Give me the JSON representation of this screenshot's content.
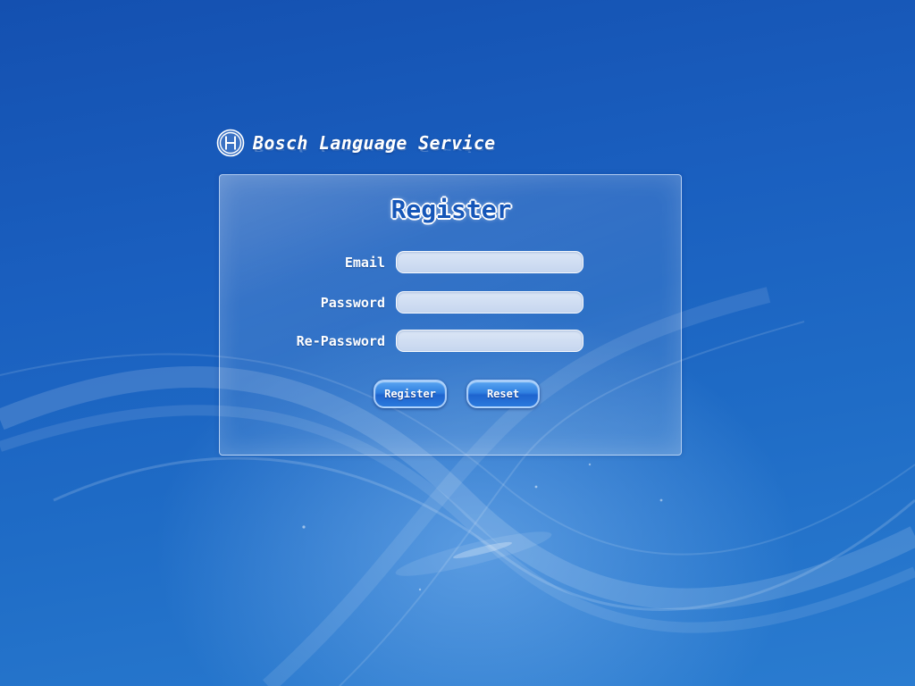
{
  "brand": {
    "name": "Bosch Language Service",
    "logo_icon": "bosch-armature-logo-icon"
  },
  "form": {
    "title": "Register",
    "fields": [
      {
        "label": "Email",
        "value": "",
        "placeholder": ""
      },
      {
        "label": "Password",
        "value": "",
        "placeholder": ""
      },
      {
        "label": "Re-Password",
        "value": "",
        "placeholder": ""
      }
    ],
    "buttons": {
      "register_label": "Register",
      "reset_label": "Reset"
    }
  },
  "colors": {
    "background_top": "#1450b0",
    "background_bottom": "#2a7cd0",
    "title_blue": "#1556b8",
    "button_blue": "#2f7fe0",
    "input_fill": "#c6d6ef"
  }
}
